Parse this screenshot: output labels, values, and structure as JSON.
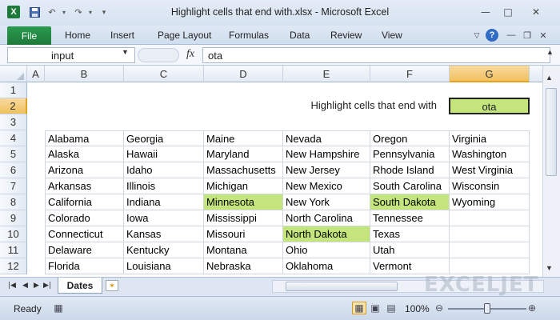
{
  "window": {
    "title": "Highlight cells that end with.xlsx  -  Microsoft Excel"
  },
  "quick_access": {
    "icons": [
      "excel-logo-icon",
      "save-icon",
      "undo-icon",
      "redo-icon",
      "customize-icon"
    ]
  },
  "ribbon": {
    "file_label": "File",
    "tabs": [
      "Home",
      "Insert",
      "Page Layout",
      "Formulas",
      "Data",
      "Review",
      "View"
    ]
  },
  "formula_bar": {
    "name_box": "input",
    "fx_label": "fx",
    "formula": "ota"
  },
  "columns": [
    "A",
    "B",
    "C",
    "D",
    "E",
    "F",
    "G"
  ],
  "rows": [
    "1",
    "2",
    "3",
    "4",
    "5",
    "6",
    "7",
    "8",
    "9",
    "10",
    "11",
    "12"
  ],
  "selected": {
    "column": "G",
    "row": "2"
  },
  "label_text": "Highlight cells that end with",
  "input_value": "ota",
  "highlight_color": "#c4e57c",
  "states": [
    [
      "Alabama",
      "Georgia",
      "Maine",
      "Nevada",
      "Oregon",
      "Virginia"
    ],
    [
      "Alaska",
      "Hawaii",
      "Maryland",
      "New Hampshire",
      "Pennsylvania",
      "Washington"
    ],
    [
      "Arizona",
      "Idaho",
      "Massachusetts",
      "New Jersey",
      "Rhode Island",
      "West Virginia"
    ],
    [
      "Arkansas",
      "Illinois",
      "Michigan",
      "New Mexico",
      "South Carolina",
      "Wisconsin"
    ],
    [
      "California",
      "Indiana",
      "Minnesota",
      "New York",
      "South Dakota",
      "Wyoming"
    ],
    [
      "Colorado",
      "Iowa",
      "Mississippi",
      "North Carolina",
      "Tennessee",
      ""
    ],
    [
      "Connecticut",
      "Kansas",
      "Missouri",
      "North Dakota",
      "Texas",
      ""
    ],
    [
      "Delaware",
      "Kentucky",
      "Montana",
      "Ohio",
      "Utah",
      ""
    ],
    [
      "Florida",
      "Louisiana",
      "Nebraska",
      "Oklahoma",
      "Vermont",
      ""
    ]
  ],
  "highlighted": [
    "Minnesota",
    "South Dakota",
    "North Dakota"
  ],
  "sheet_tabs": [
    "Dates"
  ],
  "watermark": "EXCELJET",
  "status": {
    "ready": "Ready",
    "zoom": "100%",
    "zoom_level": 0.5
  }
}
